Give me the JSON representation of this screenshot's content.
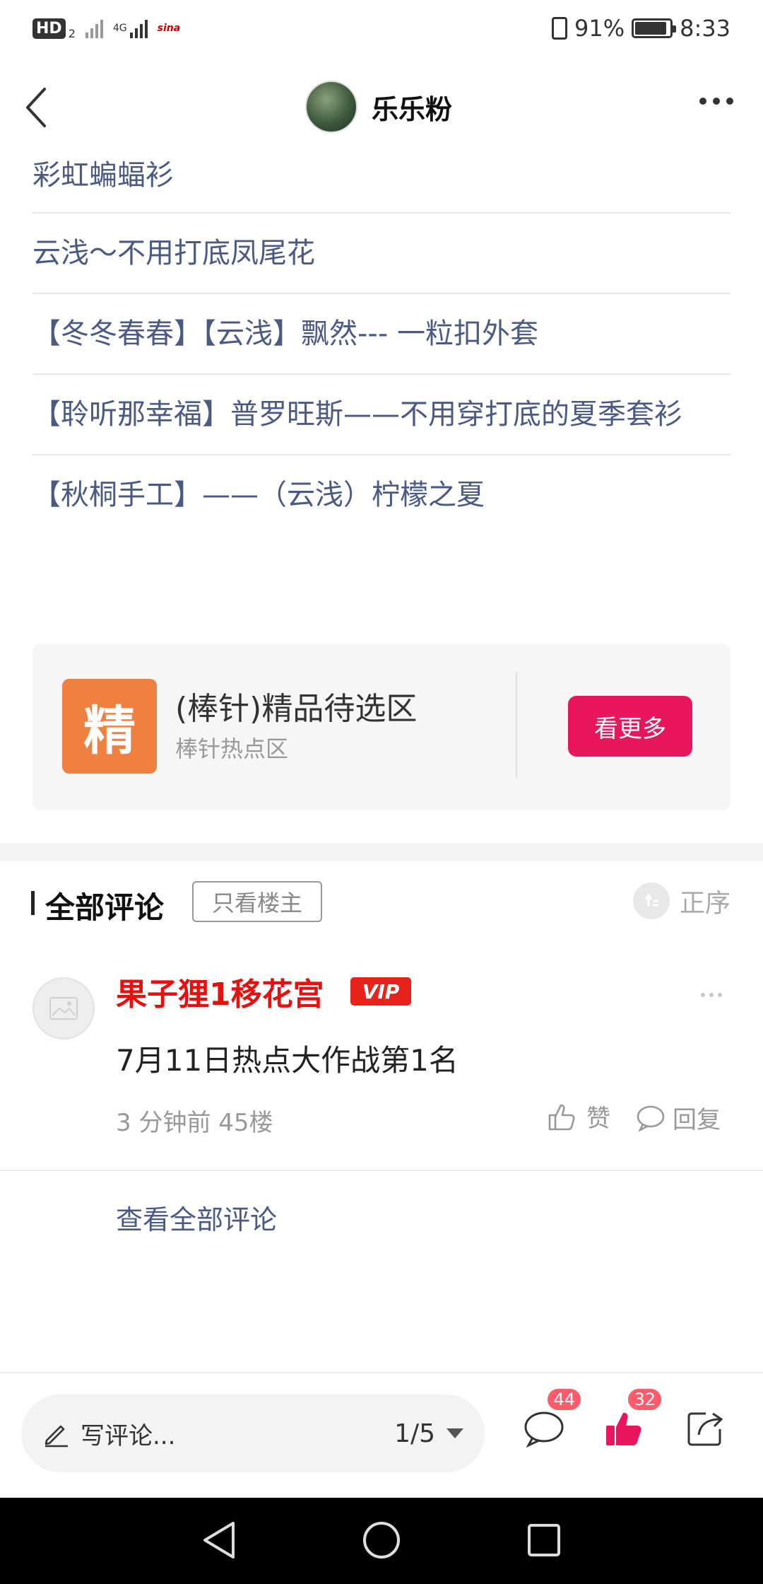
{
  "status_bar": {
    "hd": "HD",
    "hd_sub": "2",
    "network": "4G",
    "sina": "sina",
    "battery": "91%",
    "time": "8:33"
  },
  "header": {
    "author_name": "乐乐粉"
  },
  "links": [
    "彩虹蝙蝠衫",
    "云浅～不用打底凤尾花",
    "【冬冬春春】【云浅】飘然--- 一粒扣外套",
    "【聆听那幸福】普罗旺斯——不用穿打底的夏季套衫",
    "【秋桐手工】——（云浅）柠檬之夏"
  ],
  "forum_card": {
    "icon_char": "精",
    "title": "(棒针)精品待选区",
    "subtitle": "棒针热点区",
    "button": "看更多"
  },
  "comments": {
    "title": "全部评论",
    "only_op": "只看楼主",
    "sort": "正序",
    "items": [
      {
        "user": "果子狸1移花宫",
        "badge": "VIP",
        "text": "7月11日热点大作战第1名",
        "meta": "3 分钟前  45楼",
        "like_label": "赞",
        "reply_label": "回复"
      }
    ],
    "view_all": "查看全部评论"
  },
  "toolbar": {
    "input_placeholder": "写评论...",
    "page": "1/5",
    "comment_count": "44",
    "like_count": "32"
  },
  "colors": {
    "link": "#4a5a82",
    "accent": "#e8175d",
    "vip": "#e8231b",
    "forum_icon": "#f08040",
    "badge": "#ff5b6a"
  }
}
